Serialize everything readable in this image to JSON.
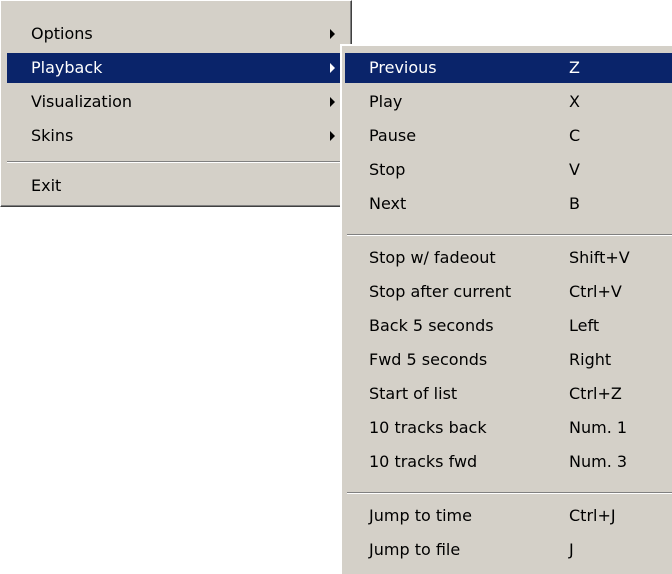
{
  "colors": {
    "menu_bg": "#d4d0c8",
    "highlight": "#0a246a",
    "highlight_text": "#ffffff"
  },
  "main_menu": {
    "options": "Options",
    "playback": "Playback",
    "visualization": "Visualization",
    "skins": "Skins",
    "exit": "Exit"
  },
  "playback_menu": {
    "previous": {
      "label": "Previous",
      "shortcut": "Z"
    },
    "play": {
      "label": "Play",
      "shortcut": "X"
    },
    "pause": {
      "label": "Pause",
      "shortcut": "C"
    },
    "stop": {
      "label": "Stop",
      "shortcut": "V"
    },
    "next": {
      "label": "Next",
      "shortcut": "B"
    },
    "stop_fadeout": {
      "label": "Stop w/ fadeout",
      "shortcut": "Shift+V"
    },
    "stop_after_current": {
      "label": "Stop after current",
      "shortcut": "Ctrl+V"
    },
    "back_5": {
      "label": "Back 5 seconds",
      "shortcut": "Left"
    },
    "fwd_5": {
      "label": "Fwd 5 seconds",
      "shortcut": "Right"
    },
    "start_of_list": {
      "label": "Start of list",
      "shortcut": "Ctrl+Z"
    },
    "tracks_back": {
      "label": "10 tracks back",
      "shortcut": "Num. 1"
    },
    "tracks_fwd": {
      "label": "10 tracks fwd",
      "shortcut": "Num. 3"
    },
    "jump_time": {
      "label": "Jump to time",
      "shortcut": "Ctrl+J"
    },
    "jump_file": {
      "label": "Jump to file",
      "shortcut": "J"
    }
  }
}
